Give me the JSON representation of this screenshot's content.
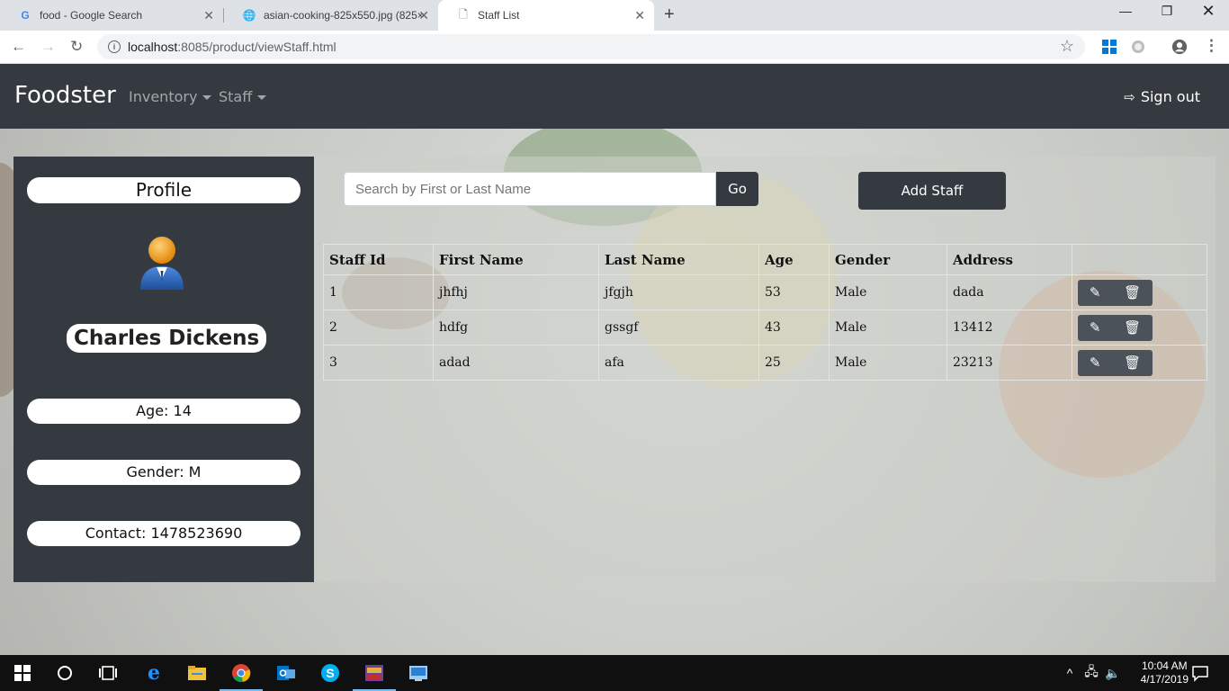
{
  "browser": {
    "tabs": [
      {
        "title": "food - Google Search",
        "active": false
      },
      {
        "title": "asian-cooking-825x550.jpg (825×",
        "active": false
      },
      {
        "title": "Staff List",
        "active": true
      }
    ],
    "url_host": "localhost",
    "url_path": ":8085/product/viewStaff.html"
  },
  "navbar": {
    "brand": "Foodster",
    "inventory": "Inventory",
    "staff": "Staff",
    "signout": "Sign out"
  },
  "profile": {
    "heading": "Profile",
    "name": "Charles Dickens",
    "age": "Age: 14",
    "gender": "Gender: M",
    "contact": "Contact: 1478523690"
  },
  "search": {
    "placeholder": "Search by First or Last Name",
    "go_label": "Go",
    "add_label": "Add Staff"
  },
  "table": {
    "headers": [
      "Staff Id",
      "First Name",
      "Last Name",
      "Age",
      "Gender",
      "Address",
      ""
    ],
    "rows": [
      [
        "1",
        "jhfhj",
        "jfgjh",
        "53",
        "Male",
        "dada"
      ],
      [
        "2",
        "hdfg",
        "gssgf",
        "43",
        "Male",
        "13412"
      ],
      [
        "3",
        "adad",
        "afa",
        "25",
        "Male",
        "23213"
      ]
    ]
  },
  "taskbar": {
    "time": "10:04 AM",
    "date": "4/17/2019"
  },
  "colors": {
    "navbar": "#343a40",
    "panel_dark": "#343a40"
  }
}
